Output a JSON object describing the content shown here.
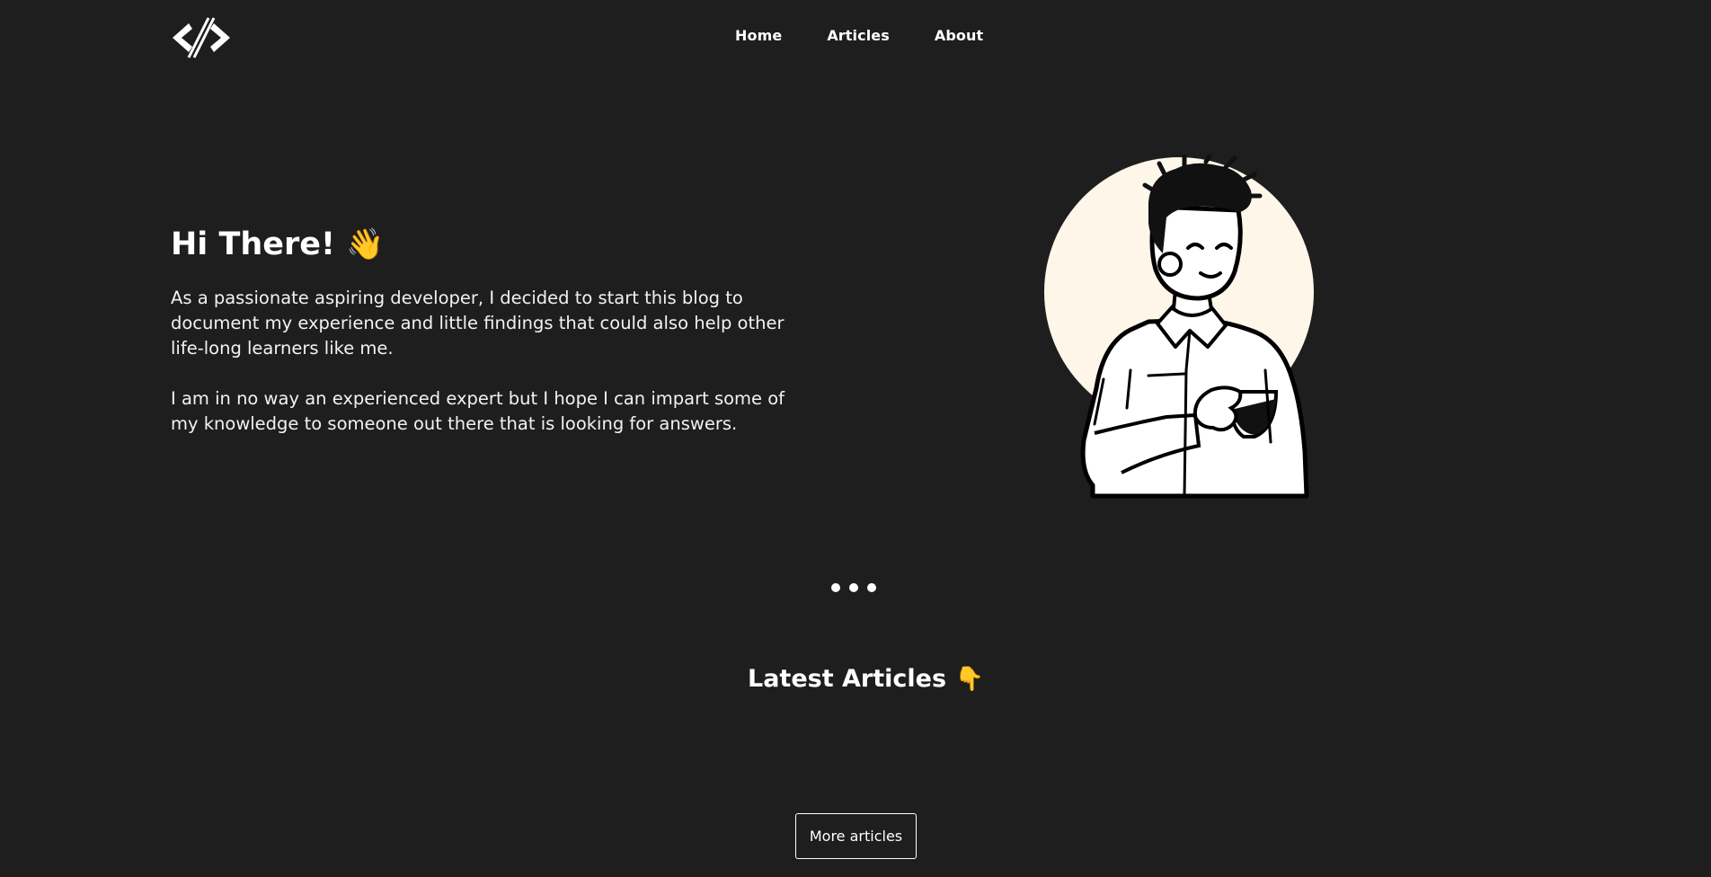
{
  "header": {
    "logo_icon": "code-slash-logo-icon",
    "nav": [
      {
        "label": "Home"
      },
      {
        "label": "Articles"
      },
      {
        "label": "About"
      }
    ]
  },
  "hero": {
    "title": "Hi There!",
    "title_emoji": "👋",
    "paragraphs": [
      "As a passionate aspiring developer, I decided to start this blog to document my experience and little findings that could also help other life-long learners like me.",
      "I am in no way an experienced expert but I hope I can impart some of my knowledge to someone out there that is looking for answers."
    ],
    "illustration_icon": "man-holding-coffee-illustration"
  },
  "divider": {
    "icon": "three-dots-divider-icon"
  },
  "latest": {
    "title": "Latest Articles",
    "title_emoji": "👇",
    "more_button": "More articles"
  },
  "colors": {
    "background": "#1e1e1e",
    "text": "#ffffff",
    "illustration_circle": "#fdf6e9"
  }
}
